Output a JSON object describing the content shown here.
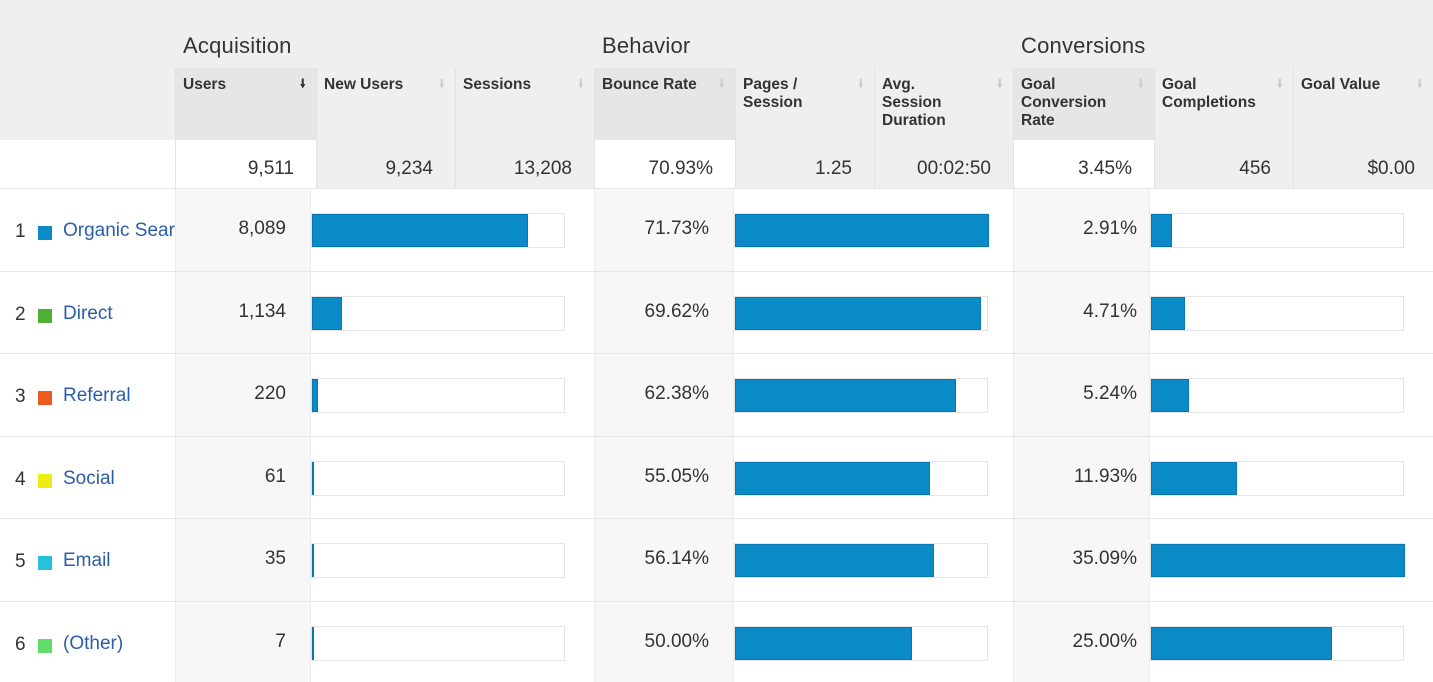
{
  "groups": {
    "acquisition": "Acquisition",
    "behavior": "Behavior",
    "conversions": "Conversions"
  },
  "columns": [
    {
      "label": "Users",
      "sorted": true
    },
    {
      "label": "New Users",
      "sorted": false
    },
    {
      "label": "Sessions",
      "sorted": false
    },
    {
      "label": "Bounce Rate",
      "sorted": false
    },
    {
      "label": "Pages / Session",
      "sorted": false
    },
    {
      "label": "Avg. Session Duration",
      "sorted": false
    },
    {
      "label": "Goal Conversion Rate",
      "sorted": false
    },
    {
      "label": "Goal Completions",
      "sorted": false
    },
    {
      "label": "Goal Value",
      "sorted": false
    }
  ],
  "sort_icon": "down-arrow",
  "totals": {
    "users": "9,511",
    "new_users": "9,234",
    "sessions": "13,208",
    "bounce_rate": "70.93%",
    "pages_per_session": "1.25",
    "avg_session_duration": "00:02:50",
    "goal_conversion_rate": "3.45%",
    "goal_completions": "456",
    "goal_value": "$0.00"
  },
  "bar_color": "#0a8bc8",
  "rows": [
    {
      "rank": "1",
      "channel": "Organic Search",
      "channel_display": "Organic Sear",
      "color": "#0a8bc8",
      "users": "8,089",
      "users_share": 0.85,
      "bounce_rate": "71.73%",
      "bounce_fill": 1.0,
      "goal_conv": "2.91%",
      "goal_fill": 0.083
    },
    {
      "rank": "2",
      "channel": "Direct",
      "channel_display": "Direct",
      "color": "#4eb034",
      "users": "1,134",
      "users_share": 0.119,
      "bounce_rate": "69.62%",
      "bounce_fill": 0.97,
      "goal_conv": "4.71%",
      "goal_fill": 0.134
    },
    {
      "rank": "3",
      "channel": "Referral",
      "channel_display": "Referral",
      "color": "#ec5a1d",
      "users": "220",
      "users_share": 0.023,
      "bounce_rate": "62.38%",
      "bounce_fill": 0.87,
      "goal_conv": "5.24%",
      "goal_fill": 0.149
    },
    {
      "rank": "4",
      "channel": "Social",
      "channel_display": "Social",
      "color": "#eded14",
      "users": "61",
      "users_share": 0.0064,
      "bounce_rate": "55.05%",
      "bounce_fill": 0.767,
      "goal_conv": "11.93%",
      "goal_fill": 0.34
    },
    {
      "rank": "5",
      "channel": "Email",
      "channel_display": "Email",
      "color": "#27c1dc",
      "users": "35",
      "users_share": 0.0037,
      "bounce_rate": "56.14%",
      "bounce_fill": 0.783,
      "goal_conv": "35.09%",
      "goal_fill": 1.0
    },
    {
      "rank": "6",
      "channel": "(Other)",
      "channel_display": "(Other)",
      "color": "#5fdc6a",
      "users": "7",
      "users_share": 0.0007,
      "bounce_rate": "50.00%",
      "bounce_fill": 0.697,
      "goal_conv": "25.00%",
      "goal_fill": 0.712
    }
  ]
}
